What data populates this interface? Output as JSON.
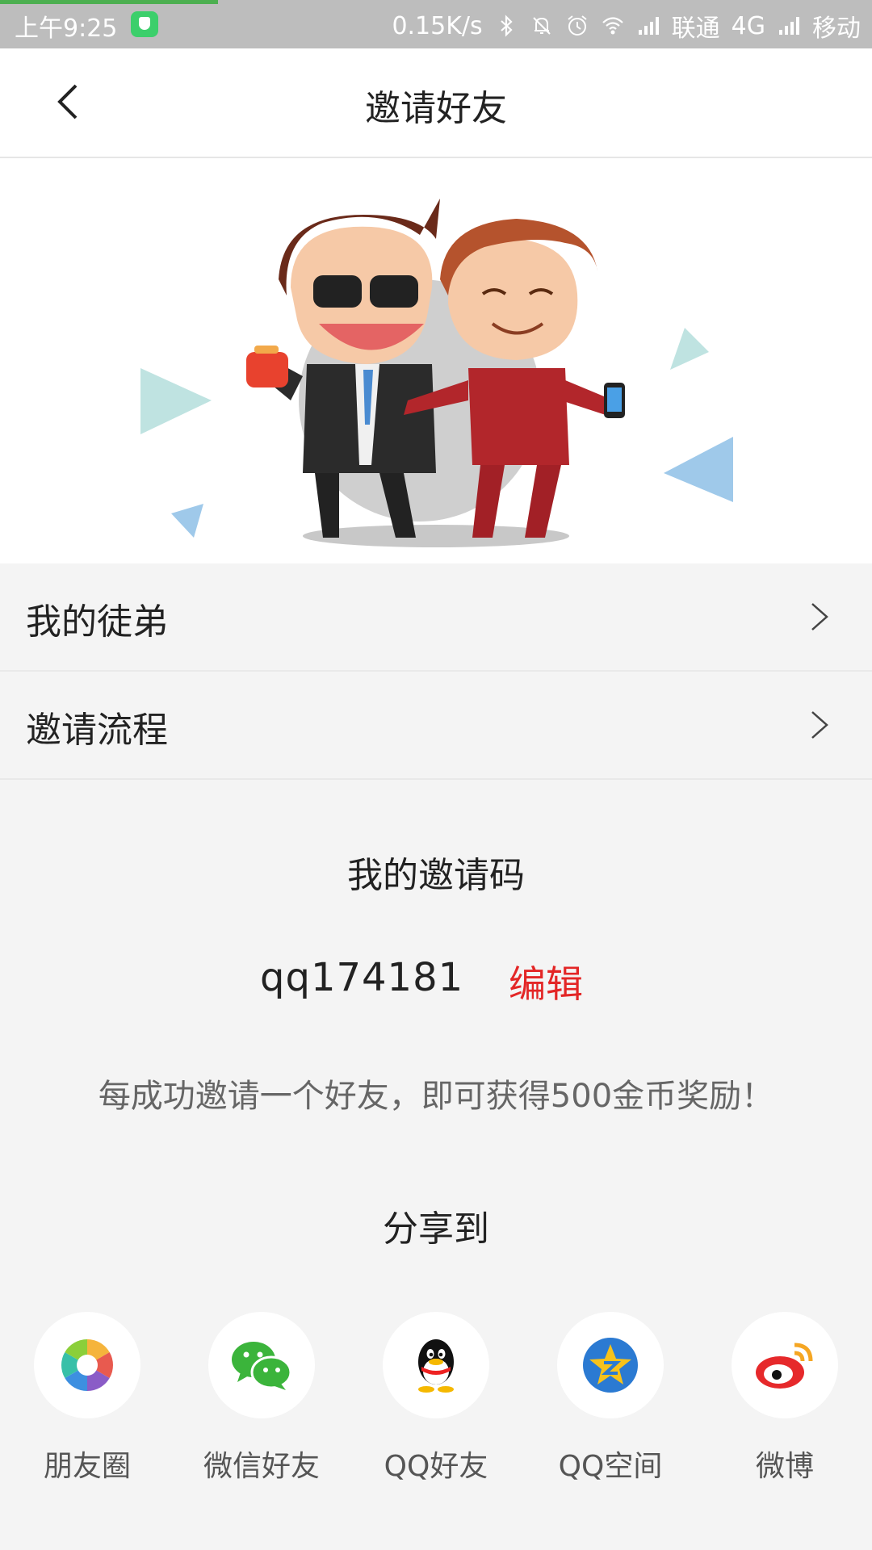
{
  "status_bar": {
    "time": "上午9:25",
    "speed": "0.15K/s",
    "carrier1": "联通",
    "network": "4G",
    "carrier2": "移动"
  },
  "header": {
    "title": "邀请好友"
  },
  "menu": [
    {
      "label": "我的徒弟"
    },
    {
      "label": "邀请流程"
    }
  ],
  "invite": {
    "title": "我的邀请码",
    "code": "qq174181",
    "edit_label": "编辑",
    "reward_text": "每成功邀请一个好友，即可获得500金币奖励！"
  },
  "share": {
    "title": "分享到",
    "items": [
      {
        "label": "朋友圈",
        "icon": "moments-icon"
      },
      {
        "label": "微信好友",
        "icon": "wechat-icon"
      },
      {
        "label": "QQ好友",
        "icon": "qq-icon"
      },
      {
        "label": "QQ空间",
        "icon": "qzone-icon"
      },
      {
        "label": "微博",
        "icon": "weibo-icon"
      }
    ]
  },
  "colors": {
    "edit_red": "#e32626",
    "background": "#f4f4f4",
    "status_bar": "#bdbdbd"
  }
}
